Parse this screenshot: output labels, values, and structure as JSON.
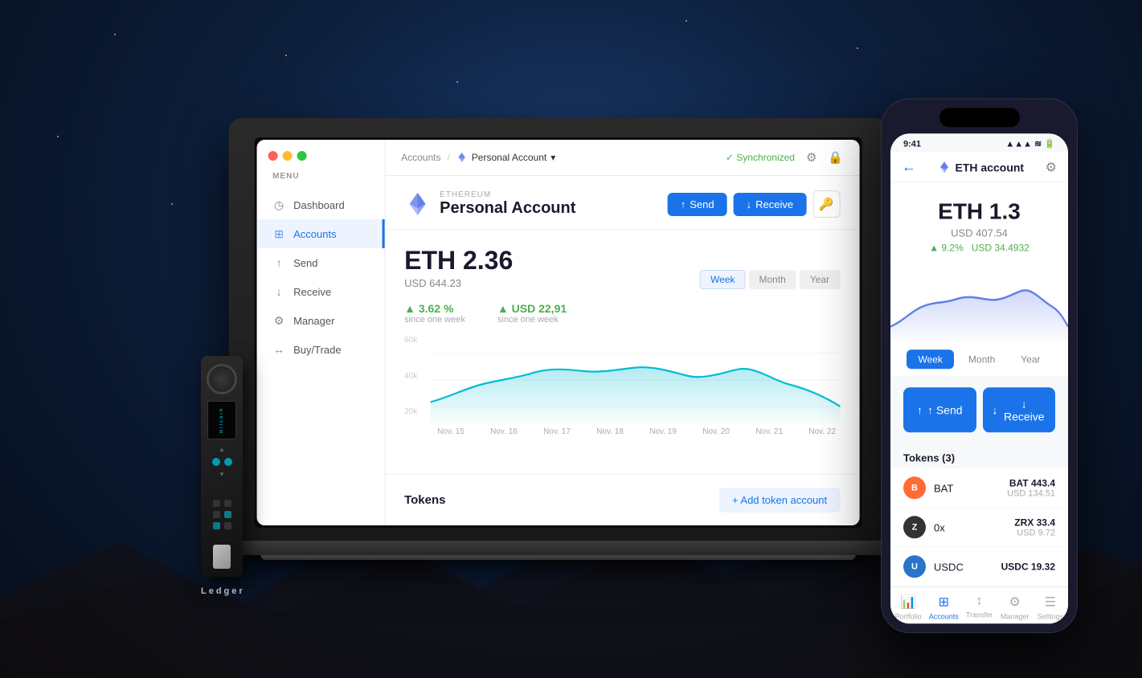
{
  "background": {
    "color": "#0a1628"
  },
  "laptop": {
    "app": {
      "traffic_lights": [
        "red",
        "yellow",
        "green"
      ],
      "topbar": {
        "breadcrumb_accounts": "Accounts",
        "breadcrumb_sep": "/",
        "account_name_breadcrumb": "Personal Account",
        "chevron": "▾",
        "sync_status": "Synchronized",
        "settings_icon": "⚙",
        "lock_icon": "🔒"
      },
      "sidebar": {
        "menu_label": "MENU",
        "items": [
          {
            "label": "Dashboard",
            "icon": "◷",
            "active": false
          },
          {
            "label": "Accounts",
            "icon": "⊞",
            "active": true
          },
          {
            "label": "Send",
            "icon": "↑",
            "active": false
          },
          {
            "label": "Receive",
            "icon": "↓",
            "active": false
          },
          {
            "label": "Manager",
            "icon": "⚙",
            "active": false
          },
          {
            "label": "Buy/Trade",
            "icon": "↔",
            "active": false
          }
        ]
      },
      "account": {
        "eth_label": "ETHEREUM",
        "account_name": "Personal Account",
        "send_btn": "Send",
        "receive_btn": "Receive",
        "key_icon": "🔑",
        "balance_eth": "ETH 2.36",
        "balance_usd": "USD 644.23",
        "time_buttons": [
          {
            "label": "Week",
            "active": true
          },
          {
            "label": "Month",
            "active": false
          },
          {
            "label": "Year",
            "active": false
          }
        ],
        "stat1_value": "▲ 3.62 %",
        "stat1_label": "since one week",
        "stat2_value": "▲ USD 22,91",
        "stat2_label": "since one week",
        "chart": {
          "y_labels": [
            "60k",
            "40k",
            "20k"
          ],
          "x_labels": [
            "Nov. 15",
            "Nov. 16",
            "Nov. 17",
            "Nov. 18",
            "Nov. 19",
            "Nov. 20",
            "Nov. 21",
            "Nov. 22"
          ]
        },
        "tokens_label": "Tokens",
        "add_token_btn": "+ Add token account"
      }
    }
  },
  "phone": {
    "statusbar": {
      "time": "9:41",
      "signal": "▲▲▲ WiFi 🔋"
    },
    "header": {
      "back_icon": "←",
      "title": "ETH account",
      "settings_icon": "⚙"
    },
    "balance": {
      "eth_amount": "ETH 1.3",
      "usd_amount": "USD 407.54",
      "gain_pct": "▲ 9.2%",
      "gain_usd": "USD 34.4932"
    },
    "time_buttons": [
      {
        "label": "Week",
        "active": true
      },
      {
        "label": "Month",
        "active": false
      },
      {
        "label": "Year",
        "active": false
      }
    ],
    "send_btn": "↑ Send",
    "receive_btn": "↓ Receive",
    "tokens_header": "Tokens (3)",
    "tokens": [
      {
        "symbol": "B",
        "name": "BAT",
        "amount": "BAT 443.4",
        "usd": "USD 134.51",
        "color": "#ff6b35"
      },
      {
        "symbol": "Z",
        "name": "0x",
        "amount": "ZRX 33.4",
        "usd": "USD 9.72",
        "color": "#333"
      },
      {
        "symbol": "U",
        "name": "USDC",
        "amount": "USDC 19.32",
        "usd": "",
        "color": "#2775ca"
      }
    ],
    "bottom_nav": [
      {
        "label": "Portfolio",
        "icon": "📊",
        "active": false
      },
      {
        "label": "Accounts",
        "icon": "⊞",
        "active": true
      },
      {
        "label": "Transfer",
        "icon": "↕",
        "active": false
      },
      {
        "label": "Manager",
        "icon": "⚙",
        "active": false
      },
      {
        "label": "Settings",
        "icon": "☰",
        "active": false
      }
    ]
  },
  "ledger": {
    "label": "Ledger",
    "screen_text": "Bitcoin"
  }
}
